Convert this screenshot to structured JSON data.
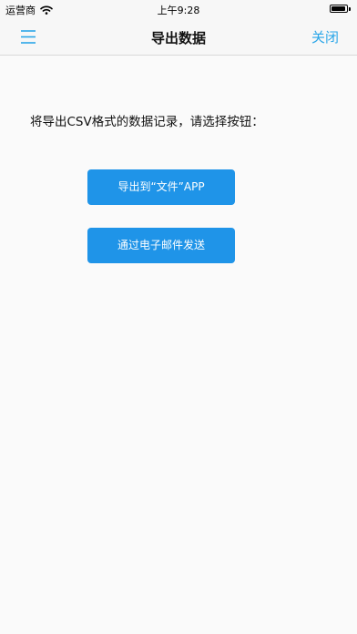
{
  "status_bar": {
    "carrier": "运营商",
    "time": "上午9:28",
    "battery_level": 0.95
  },
  "nav": {
    "title": "导出数据",
    "close_label": "关闭",
    "menu_icon": "menu-icon"
  },
  "main": {
    "instruction": "将导出CSV格式的数据记录，请选择按钮：",
    "export_files_label": "导出到“文件”APP",
    "export_email_label": "通过电子邮件发送"
  },
  "colors": {
    "accent": "#2aa6e8",
    "button": "#1f94e8",
    "background": "#fafafa"
  }
}
